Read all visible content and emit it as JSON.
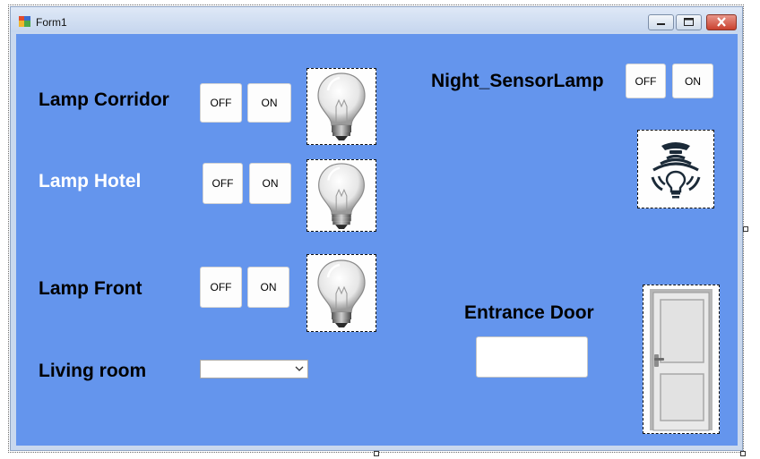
{
  "window": {
    "title": "Form1"
  },
  "lamps": [
    {
      "label": "Lamp Corridor",
      "off": "OFF",
      "on": "ON",
      "icon": "light-bulb-icon"
    },
    {
      "label": "Lamp Hotel",
      "off": "OFF",
      "on": "ON",
      "icon": "light-bulb-icon"
    },
    {
      "label": "Lamp Front",
      "off": "OFF",
      "on": "ON",
      "icon": "light-bulb-icon"
    }
  ],
  "living_room": {
    "label": "Living room",
    "selected": ""
  },
  "night_sensor": {
    "label": "Night_SensorLamp",
    "off": "OFF",
    "on": "ON",
    "icon": "sensor-lamp-icon"
  },
  "entrance": {
    "label": "Entrance Door",
    "value": "",
    "icon": "door-icon"
  },
  "colors": {
    "client_background": "#6495ED",
    "hotel_label": "#FFFFFF"
  }
}
